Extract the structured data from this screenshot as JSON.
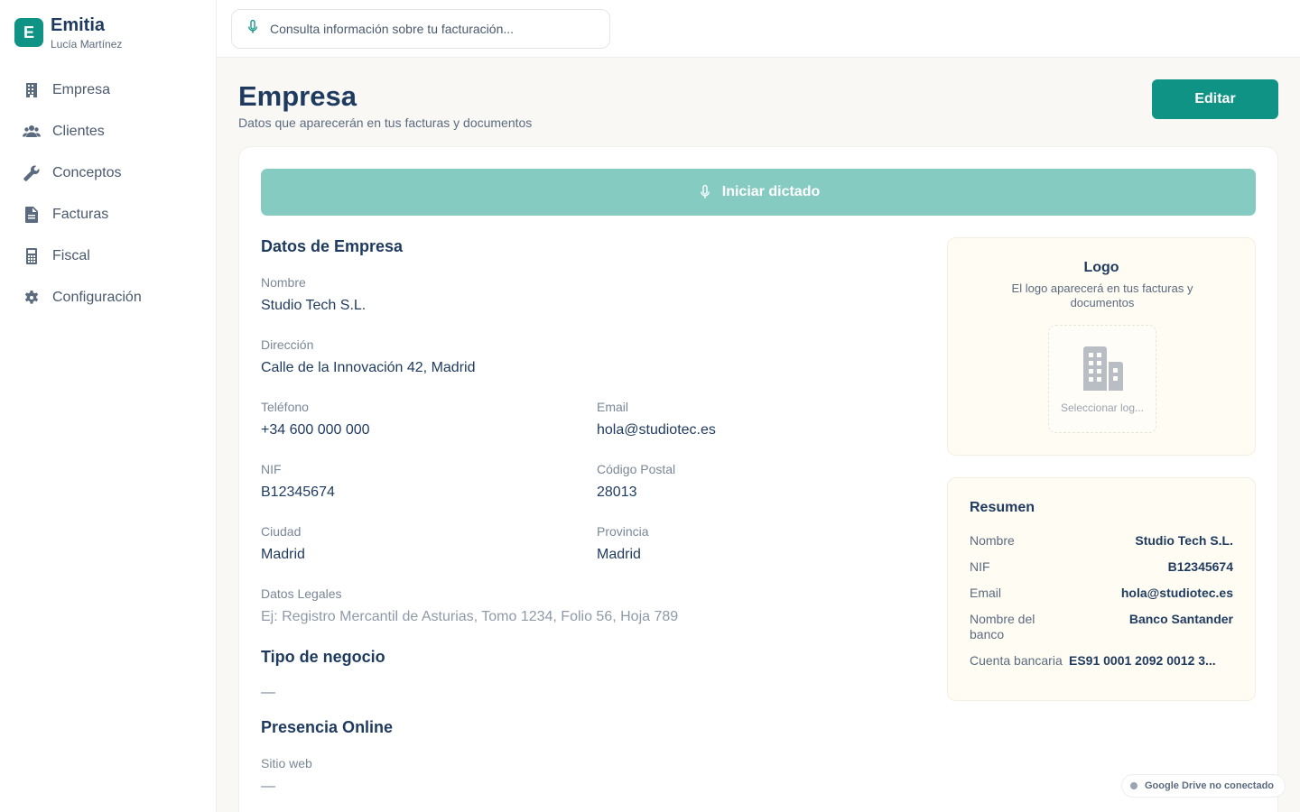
{
  "brand": {
    "initial": "E",
    "name": "Emitia",
    "user": "Lucía Martínez"
  },
  "sidebar": {
    "items": [
      {
        "label": "Empresa",
        "icon": "building-icon"
      },
      {
        "label": "Clientes",
        "icon": "users-icon"
      },
      {
        "label": "Conceptos",
        "icon": "wrench-icon"
      },
      {
        "label": "Facturas",
        "icon": "document-icon"
      },
      {
        "label": "Fiscal",
        "icon": "calculator-icon"
      },
      {
        "label": "Configuración",
        "icon": "gear-icon"
      }
    ]
  },
  "search": {
    "placeholder": "Consulta información sobre tu facturación...",
    "icon": "microphone-icon"
  },
  "header": {
    "title": "Empresa",
    "subtitle": "Datos que aparecerán en tus facturas y documentos",
    "edit_label": "Editar"
  },
  "dictate": {
    "label": "Iniciar dictado",
    "icon": "microphone-icon"
  },
  "company": {
    "section_title": "Datos de Empresa",
    "nombre": {
      "label": "Nombre",
      "value": "Studio Tech S.L."
    },
    "direccion": {
      "label": "Dirección",
      "value": "Calle de la Innovación 42, Madrid"
    },
    "telefono": {
      "label": "Teléfono",
      "value": "+34 600 000 000"
    },
    "email": {
      "label": "Email",
      "value": "hola@studiotec.es"
    },
    "nif": {
      "label": "NIF",
      "value": "B12345674"
    },
    "codigo_postal": {
      "label": "Código Postal",
      "value": "28013"
    },
    "ciudad": {
      "label": "Ciudad",
      "value": "Madrid"
    },
    "provincia": {
      "label": "Provincia",
      "value": "Madrid"
    },
    "datos_legales": {
      "label": "Datos Legales",
      "placeholder": "Ej: Registro Mercantil de Asturias, Tomo 1234, Folio 56, Hoja 789"
    }
  },
  "business_type": {
    "section_title": "Tipo de negocio",
    "value": "—"
  },
  "online": {
    "section_title": "Presencia Online",
    "website_label": "Sitio web",
    "website_value": "—"
  },
  "logo": {
    "title": "Logo",
    "description": "El logo aparecerá en tus facturas y documentos",
    "select_label": "Seleccionar log..."
  },
  "summary": {
    "title": "Resumen",
    "rows": [
      {
        "label": "Nombre",
        "value": "Studio Tech S.L."
      },
      {
        "label": "NIF",
        "value": "B12345674"
      },
      {
        "label": "Email",
        "value": "hola@studiotec.es"
      },
      {
        "label": "Nombre del banco",
        "value": "Banco Santander"
      },
      {
        "label": "Cuenta bancaria",
        "value": "ES91 0001 2092 0012 3..."
      }
    ]
  },
  "drive_status": "Google Drive no conectado",
  "colors": {
    "accent": "#0e9384",
    "accent_light": "#86cbc2",
    "text_primary": "#1e3a5f",
    "panel_bg": "#fffcf4"
  }
}
